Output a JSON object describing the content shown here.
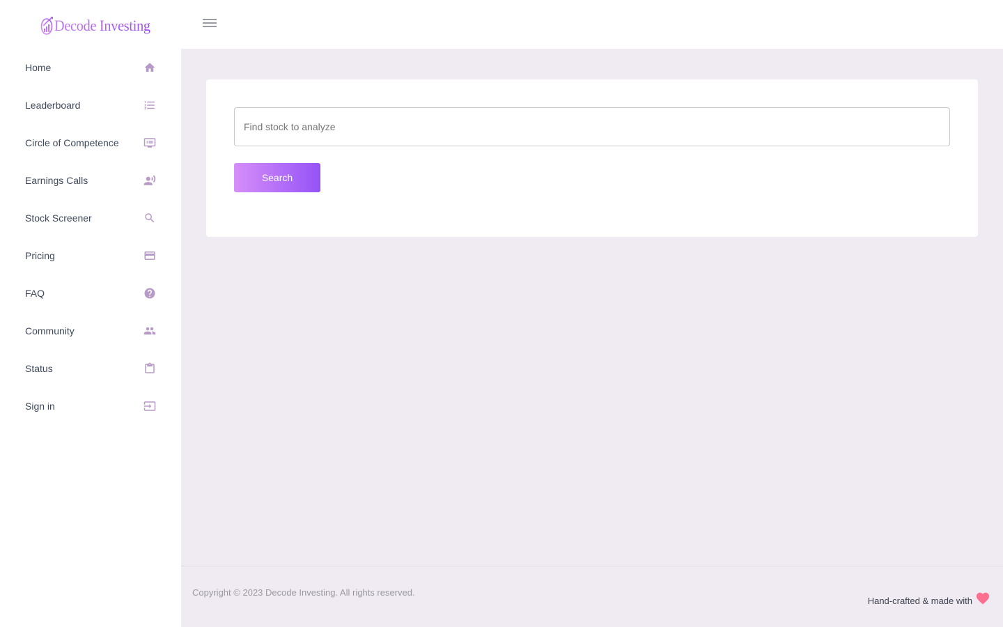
{
  "brand": {
    "name": "Decode Investing",
    "accent_gradient": [
      "#d68ef8",
      "#9553f7"
    ]
  },
  "sidebar": {
    "items": [
      {
        "label": "Home",
        "icon": "home-icon"
      },
      {
        "label": "Leaderboard",
        "icon": "numbered-list-icon"
      },
      {
        "label": "Circle of Competence",
        "icon": "monitor-list-icon"
      },
      {
        "label": "Earnings Calls",
        "icon": "speaker-person-icon"
      },
      {
        "label": "Stock Screener",
        "icon": "search-icon"
      },
      {
        "label": "Pricing",
        "icon": "credit-card-icon"
      },
      {
        "label": "FAQ",
        "icon": "help-circle-icon"
      },
      {
        "label": "Community",
        "icon": "people-icon"
      },
      {
        "label": "Status",
        "icon": "clipboard-icon"
      },
      {
        "label": "Sign in",
        "icon": "sign-in-icon"
      }
    ],
    "icon_color": "#b79ac6"
  },
  "topbar": {
    "menu_icon": "hamburger-menu-icon"
  },
  "search": {
    "placeholder": "Find stock to analyze",
    "value": "",
    "button_label": "Search"
  },
  "footer": {
    "copyright": "Copyright © 2023 Decode Investing. All rights reserved.",
    "made_with": "Hand-crafted & made with",
    "heart_color": "#fc6f8f"
  }
}
